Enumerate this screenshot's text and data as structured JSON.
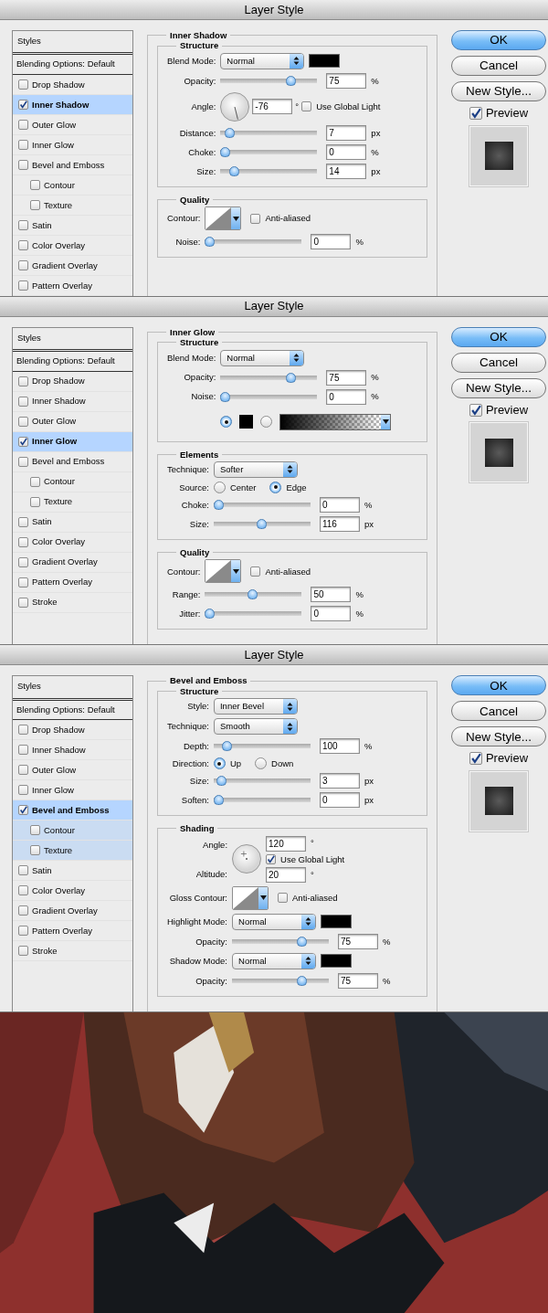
{
  "dialogs": [
    {
      "title": "Layer Style",
      "styles": {
        "header": "Styles",
        "blending": "Blending Options: Default",
        "items": [
          {
            "label": "Drop Shadow",
            "checked": false,
            "selected": false
          },
          {
            "label": "Inner Shadow",
            "checked": true,
            "selected": true
          },
          {
            "label": "Outer Glow",
            "checked": false,
            "selected": false
          },
          {
            "label": "Inner Glow",
            "checked": false,
            "selected": false
          },
          {
            "label": "Bevel and Emboss",
            "checked": false,
            "selected": false,
            "children": [
              {
                "label": "Contour",
                "checked": false,
                "selected": false
              },
              {
                "label": "Texture",
                "checked": false,
                "selected": false
              }
            ]
          },
          {
            "label": "Satin",
            "checked": false,
            "selected": false
          },
          {
            "label": "Color Overlay",
            "checked": false,
            "selected": false
          },
          {
            "label": "Gradient Overlay",
            "checked": false,
            "selected": false
          },
          {
            "label": "Pattern Overlay",
            "checked": false,
            "selected": false
          }
        ]
      },
      "panel": {
        "title": "Inner Shadow",
        "sections": [
          {
            "title": "Structure",
            "rows": [
              {
                "kind": "select",
                "label": "Blend Mode:",
                "value": "Normal",
                "color": "#000000"
              },
              {
                "kind": "slider",
                "label": "Opacity:",
                "level": 0.75,
                "value": "75",
                "unit": "%"
              },
              {
                "kind": "angle",
                "label": "Angle:",
                "value": "-76",
                "unit": "°",
                "checkbox": {
                  "label": "Use Global Light",
                  "checked": false
                }
              },
              {
                "kind": "slider",
                "label": "Distance:",
                "level": 0.05,
                "value": "7",
                "unit": "px"
              },
              {
                "kind": "slider",
                "label": "Choke:",
                "level": 0,
                "value": "0",
                "unit": "%"
              },
              {
                "kind": "slider",
                "label": "Size:",
                "level": 0.1,
                "value": "14",
                "unit": "px"
              }
            ]
          },
          {
            "title": "Quality",
            "rows": [
              {
                "kind": "contour",
                "label": "Contour:",
                "checkbox": {
                  "label": "Anti-aliased",
                  "checked": false
                }
              },
              {
                "kind": "slider",
                "label": "Noise:",
                "level": 0,
                "value": "0",
                "unit": "%"
              }
            ]
          }
        ]
      },
      "buttons": [
        {
          "label": "OK",
          "primary": true
        },
        {
          "label": "Cancel",
          "primary": false
        },
        {
          "label": "New Style...",
          "primary": false
        }
      ],
      "preview": {
        "label": "Preview",
        "checked": true
      }
    },
    {
      "title": "Layer Style",
      "styles": {
        "header": "Styles",
        "blending": "Blending Options: Default",
        "items": [
          {
            "label": "Drop Shadow",
            "checked": false,
            "selected": false
          },
          {
            "label": "Inner Shadow",
            "checked": false,
            "selected": false
          },
          {
            "label": "Outer Glow",
            "checked": false,
            "selected": false
          },
          {
            "label": "Inner Glow",
            "checked": true,
            "selected": true
          },
          {
            "label": "Bevel and Emboss",
            "checked": false,
            "selected": false,
            "children": [
              {
                "label": "Contour",
                "checked": false,
                "selected": false
              },
              {
                "label": "Texture",
                "checked": false,
                "selected": false
              }
            ]
          },
          {
            "label": "Satin",
            "checked": false,
            "selected": false
          },
          {
            "label": "Color Overlay",
            "checked": false,
            "selected": false
          },
          {
            "label": "Gradient Overlay",
            "checked": false,
            "selected": false
          },
          {
            "label": "Pattern Overlay",
            "checked": false,
            "selected": false
          },
          {
            "label": "Stroke",
            "checked": false,
            "selected": false
          }
        ]
      },
      "panel": {
        "title": "Inner Glow",
        "sections": [
          {
            "title": "Structure",
            "rows": [
              {
                "kind": "select",
                "label": "Blend Mode:",
                "value": "Normal"
              },
              {
                "kind": "slider",
                "label": "Opacity:",
                "level": 0.75,
                "value": "75",
                "unit": "%"
              },
              {
                "kind": "slider",
                "label": "Noise:",
                "level": 0,
                "value": "0",
                "unit": "%"
              },
              {
                "kind": "fill",
                "options": [
                  {
                    "kind": "color",
                    "selected": true,
                    "color": "#000000"
                  },
                  {
                    "kind": "gradient",
                    "selected": false
                  }
                ]
              }
            ]
          },
          {
            "title": "Elements",
            "rows": [
              {
                "kind": "select",
                "label": "Technique:",
                "value": "Softer"
              },
              {
                "kind": "radio",
                "label": "Source:",
                "options": [
                  {
                    "label": "Center",
                    "selected": false
                  },
                  {
                    "label": "Edge",
                    "selected": true
                  }
                ]
              },
              {
                "kind": "slider",
                "label": "Choke:",
                "level": 0,
                "value": "0",
                "unit": "%"
              },
              {
                "kind": "slider",
                "label": "Size:",
                "level": 0.49,
                "value": "116",
                "unit": "px"
              }
            ]
          },
          {
            "title": "Quality",
            "rows": [
              {
                "kind": "contour",
                "label": "Contour:",
                "checkbox": {
                  "label": "Anti-aliased",
                  "checked": false
                }
              },
              {
                "kind": "slider",
                "label": "Range:",
                "level": 0.49,
                "value": "50",
                "unit": "%"
              },
              {
                "kind": "slider",
                "label": "Jitter:",
                "level": 0,
                "value": "0",
                "unit": "%"
              }
            ]
          }
        ]
      },
      "buttons": [
        {
          "label": "OK",
          "primary": true
        },
        {
          "label": "Cancel",
          "primary": false
        },
        {
          "label": "New Style...",
          "primary": false
        }
      ],
      "preview": {
        "label": "Preview",
        "checked": true
      }
    },
    {
      "title": "Layer Style",
      "styles": {
        "header": "Styles",
        "blending": "Blending Options: Default",
        "items": [
          {
            "label": "Drop Shadow",
            "checked": false,
            "selected": false
          },
          {
            "label": "Inner Shadow",
            "checked": false,
            "selected": false
          },
          {
            "label": "Outer Glow",
            "checked": false,
            "selected": false
          },
          {
            "label": "Inner Glow",
            "checked": false,
            "selected": false
          },
          {
            "label": "Bevel and Emboss",
            "checked": true,
            "selected": true,
            "children": [
              {
                "label": "Contour",
                "checked": false,
                "selected": false
              },
              {
                "label": "Texture",
                "checked": false,
                "selected": false
              }
            ]
          },
          {
            "label": "Satin",
            "checked": false,
            "selected": false
          },
          {
            "label": "Color Overlay",
            "checked": false,
            "selected": false
          },
          {
            "label": "Gradient Overlay",
            "checked": false,
            "selected": false
          },
          {
            "label": "Pattern Overlay",
            "checked": false,
            "selected": false
          },
          {
            "label": "Stroke",
            "checked": false,
            "selected": false
          }
        ]
      },
      "panel": {
        "title": "Bevel and Emboss",
        "sections": [
          {
            "title": "Structure",
            "rows": [
              {
                "kind": "select",
                "label": "Style:",
                "value": "Inner Bevel"
              },
              {
                "kind": "select",
                "label": "Technique:",
                "value": "Smooth"
              },
              {
                "kind": "slider",
                "label": "Depth:",
                "level": 0.1,
                "value": "100",
                "unit": "%"
              },
              {
                "kind": "radio",
                "label": "Direction:",
                "options": [
                  {
                    "label": "Up",
                    "selected": true
                  },
                  {
                    "label": "Down",
                    "selected": false
                  }
                ]
              },
              {
                "kind": "slider",
                "label": "Size:",
                "level": 0.03,
                "value": "3",
                "unit": "px"
              },
              {
                "kind": "slider",
                "label": "Soften:",
                "level": 0,
                "value": "0",
                "unit": "px"
              }
            ]
          },
          {
            "title": "Shading",
            "rows": [
              {
                "kind": "shading",
                "angle_label": "Angle:",
                "angle_value": "120",
                "altitude_label": "Altitude:",
                "altitude_value": "20",
                "unit": "°",
                "checkbox": {
                  "label": "Use Global Light",
                  "checked": true
                }
              },
              {
                "kind": "contour",
                "label": "Gloss Contour:",
                "checkbox": {
                  "label": "Anti-aliased",
                  "checked": false
                }
              },
              {
                "kind": "select",
                "label": "Highlight Mode:",
                "value": "Normal",
                "color": "#000000"
              },
              {
                "kind": "slider",
                "label": "Opacity:",
                "level": 0.75,
                "value": "75",
                "unit": "%"
              },
              {
                "kind": "select",
                "label": "Shadow Mode:",
                "value": "Normal",
                "color": "#000000"
              },
              {
                "kind": "slider",
                "label": "Opacity:",
                "level": 0.75,
                "value": "75",
                "unit": "%"
              }
            ]
          }
        ]
      },
      "buttons": [
        {
          "label": "OK",
          "primary": true
        },
        {
          "label": "Cancel",
          "primary": false
        },
        {
          "label": "New Style...",
          "primary": false
        }
      ],
      "preview": {
        "label": "Preview",
        "checked": true
      }
    }
  ]
}
